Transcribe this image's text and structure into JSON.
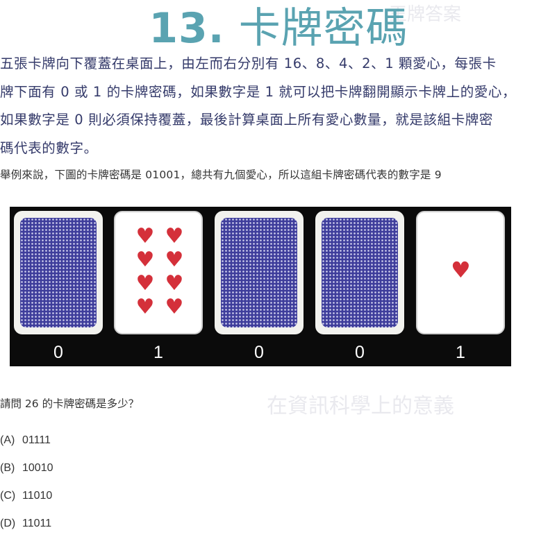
{
  "title": {
    "number": "13.",
    "text": "卡牌密碼"
  },
  "paragraph": [
    "五張卡牌向下覆蓋在桌面上，由左而右分別有 16、8、4、2、1 顆愛心，每張卡",
    "牌下面有 0 或 1 的卡牌密碼，如果數字是 1 就可以把卡牌翻開顯示卡牌上的愛心，",
    "如果數字是 0 則必須保持覆蓋，最後計算桌面上所有愛心數量，就是該組卡牌密",
    "碼代表的數字。"
  ],
  "example": "舉例來說，下圖的卡牌密碼是 01001，總共有九個愛心，所以這組卡牌密碼代表的數字是 9",
  "cards": [
    {
      "digit": "0",
      "face_up": false,
      "hearts": 16
    },
    {
      "digit": "1",
      "face_up": true,
      "hearts": 8
    },
    {
      "digit": "0",
      "face_up": false,
      "hearts": 4
    },
    {
      "digit": "0",
      "face_up": false,
      "hearts": 2
    },
    {
      "digit": "1",
      "face_up": true,
      "hearts": 1
    }
  ],
  "question": "請問 26 的卡牌密碼是多少？",
  "options": [
    {
      "letter": "(A)",
      "value": "01111"
    },
    {
      "letter": "(B)",
      "value": "10010"
    },
    {
      "letter": "(C)",
      "value": "11010"
    },
    {
      "letter": "(D)",
      "value": "11011"
    }
  ],
  "colors": {
    "title": "#5aa3b1",
    "paragraph": "#343a6a",
    "card_back": "#3e3d9b",
    "heart": "#d4303a",
    "panel": "#0b0b0b"
  },
  "icons": {
    "heart": "heart-icon"
  }
}
